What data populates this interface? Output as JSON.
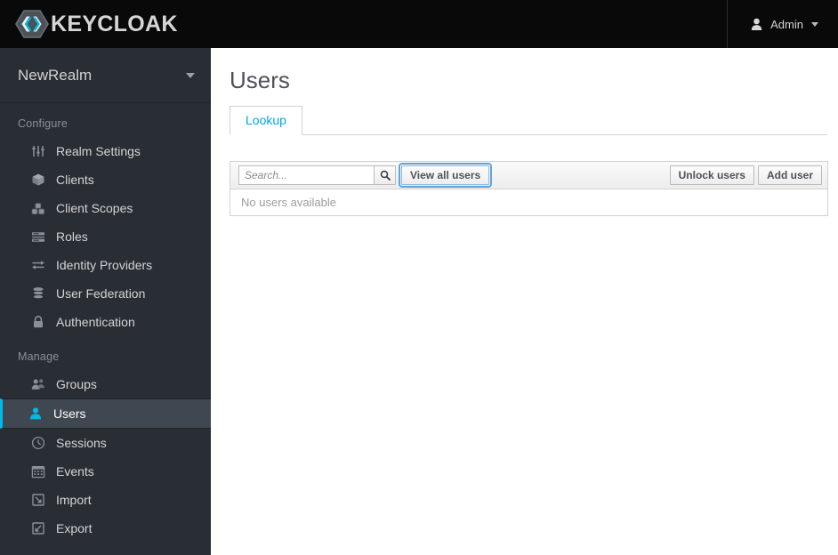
{
  "masthead": {
    "brand_text": "KEYCLOAK",
    "brand_logo_icon": "keycloak-hexagon-logo",
    "user_icon": "user-icon",
    "user_name": "Admin",
    "caret_icon": "chevron-down-icon"
  },
  "sidebar": {
    "realm": {
      "name": "NewRealm",
      "caret_icon": "chevron-down-icon"
    },
    "sections": [
      {
        "title": "Configure",
        "items": [
          {
            "label": "Realm Settings",
            "icon": "sliders-icon",
            "active": false
          },
          {
            "label": "Clients",
            "icon": "cube-icon",
            "active": false
          },
          {
            "label": "Client Scopes",
            "icon": "blocks-icon",
            "active": false
          },
          {
            "label": "Roles",
            "icon": "list-rows-icon",
            "active": false
          },
          {
            "label": "Identity Providers",
            "icon": "exchange-arrows-icon",
            "active": false
          },
          {
            "label": "User Federation",
            "icon": "database-icon",
            "active": false
          },
          {
            "label": "Authentication",
            "icon": "lock-icon",
            "active": false
          }
        ]
      },
      {
        "title": "Manage",
        "items": [
          {
            "label": "Groups",
            "icon": "users-group-icon",
            "active": false
          },
          {
            "label": "Users",
            "icon": "user-icon",
            "active": true
          },
          {
            "label": "Sessions",
            "icon": "clock-icon",
            "active": false
          },
          {
            "label": "Events",
            "icon": "calendar-icon",
            "active": false
          },
          {
            "label": "Import",
            "icon": "arrow-into-box-icon",
            "active": false
          },
          {
            "label": "Export",
            "icon": "arrow-out-of-box-icon",
            "active": false
          }
        ]
      }
    ]
  },
  "main": {
    "page_title": "Users",
    "tabs": [
      {
        "label": "Lookup",
        "active": true
      }
    ],
    "toolbar": {
      "search_placeholder": "Search...",
      "search_value": "",
      "search_icon": "magnifier-icon",
      "view_all_users_label": "View all users",
      "unlock_users_label": "Unlock users",
      "add_user_label": "Add user"
    },
    "table": {
      "empty_message": "No users available"
    }
  },
  "colors": {
    "accent_cyan": "#00b9e4",
    "link_blue": "#0088ce",
    "sidebar_bg": "#292e34",
    "sidebar_active_bg": "#3f4750",
    "masthead_bg": "#090909",
    "heading_gray": "#4d5258",
    "border_gray": "#d1d1d1"
  }
}
